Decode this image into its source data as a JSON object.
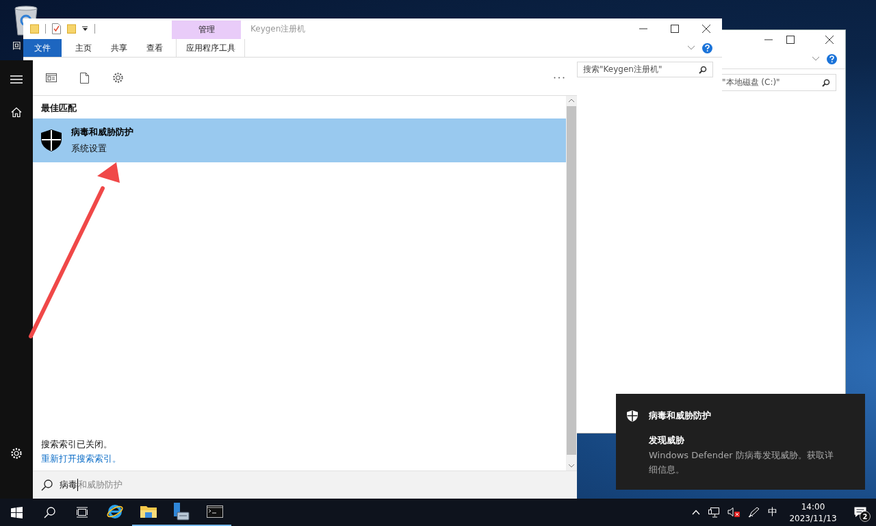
{
  "desktop": {
    "icons": [
      {
        "label": "回"
      }
    ]
  },
  "back_window": {
    "search": {
      "placeholder": "\"本地磁盘 (C:)\""
    }
  },
  "explorer": {
    "title": "Keygen注册机",
    "context_group": "管理",
    "tabs": [
      {
        "label": "文件",
        "kind": "file"
      },
      {
        "label": "主页",
        "kind": "normal"
      },
      {
        "label": "共享",
        "kind": "normal"
      },
      {
        "label": "查看",
        "kind": "normal"
      },
      {
        "label": "应用程序工具",
        "kind": "context"
      }
    ],
    "search": {
      "placeholder": "搜索\"Keygen注册机\""
    }
  },
  "start_search": {
    "section_title": "最佳匹配",
    "results": [
      {
        "title": "病毒和威胁防护",
        "subtitle": "系统设置",
        "selected": true
      }
    ],
    "index_notice": "搜索索引已关闭。",
    "index_link": "重新打开搜索索引。",
    "query": {
      "typed": "病毒",
      "suggestion": "和威胁防护"
    }
  },
  "notification": {
    "app": "病毒和威胁防护",
    "title": "发现威胁",
    "body": "Windows Defender 防病毒发现威胁。获取详细信息。"
  },
  "taskbar": {
    "apps": [
      {
        "kind": "ie",
        "running": false
      },
      {
        "kind": "explorer",
        "running": true
      },
      {
        "kind": "server",
        "running": true
      },
      {
        "kind": "cmd",
        "running": true
      }
    ],
    "ime": "中",
    "time": "14:00",
    "date": "2023/11/13",
    "notification_count": "2"
  }
}
